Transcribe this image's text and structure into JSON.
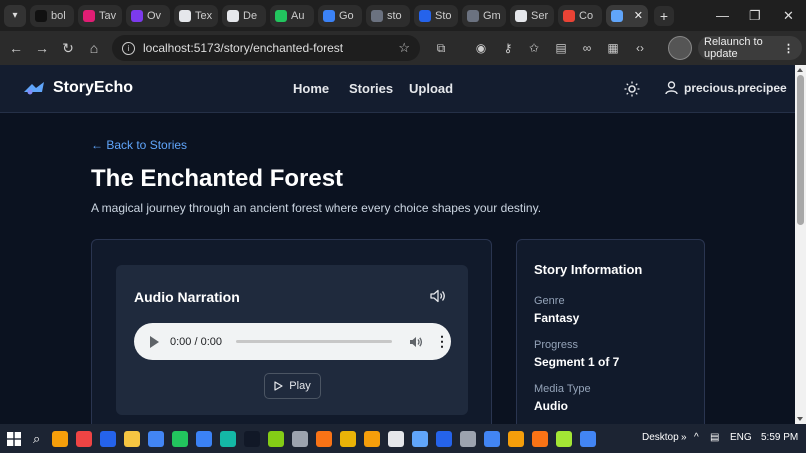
{
  "browser": {
    "tabs": [
      {
        "label": "bol",
        "color": "#111111"
      },
      {
        "label": "Tav",
        "color": "#e11d74"
      },
      {
        "label": "Ov",
        "color": "#7c3aed"
      },
      {
        "label": "Tex",
        "color": "#e5e7eb"
      },
      {
        "label": "De",
        "color": "#e5e7eb"
      },
      {
        "label": "Au",
        "color": "#22c55e"
      },
      {
        "label": "Go",
        "color": "#3b82f6"
      },
      {
        "label": "sto",
        "color": "#6b7280"
      },
      {
        "label": "Sto",
        "color": "#2563eb"
      },
      {
        "label": "Gm",
        "color": "#6b7280"
      },
      {
        "label": "Ser",
        "color": "#e5e7eb"
      },
      {
        "label": "Co",
        "color": "#ea4335"
      }
    ],
    "active_tab_close": "✕",
    "new_tab": "+",
    "url": "localhost:5173/story/enchanted-forest",
    "relaunch_label": "Relaunch to update"
  },
  "app": {
    "brand": "StoryEcho",
    "nav": {
      "home": "Home",
      "stories": "Stories",
      "upload": "Upload"
    },
    "username": "precious.precipee",
    "accent": "#60a5fa"
  },
  "story": {
    "back_link": "← Back to Stories",
    "title": "The Enchanted Forest",
    "description": "A magical journey through an ancient forest where every choice shapes your destiny."
  },
  "audio": {
    "heading": "Audio Narration",
    "time": "0:00 / 0:00",
    "play_label": "Play"
  },
  "info": {
    "heading": "Story Information",
    "genre_label": "Genre",
    "genre": "Fantasy",
    "progress_label": "Progress",
    "progress": "Segment 1 of 7",
    "media_label": "Media Type",
    "media": "Audio"
  },
  "taskbar": {
    "desktop_label": "Desktop",
    "lang": "ENG",
    "time": "5:59 PM",
    "apps": [
      "#f59e0b",
      "#ef4444",
      "#2563eb",
      "#f5c542",
      "#4285f4",
      "#22c55e",
      "#3b82f6",
      "#14b8a6",
      "#111827",
      "#84cc16",
      "#9ca3af",
      "#f97316",
      "#eab308",
      "#f59e0b",
      "#e5e7eb",
      "#60a5fa",
      "#2563eb",
      "#9ca3af",
      "#4285f4",
      "#f59e0b",
      "#f97316",
      "#a3e635",
      "#4285f4"
    ]
  }
}
